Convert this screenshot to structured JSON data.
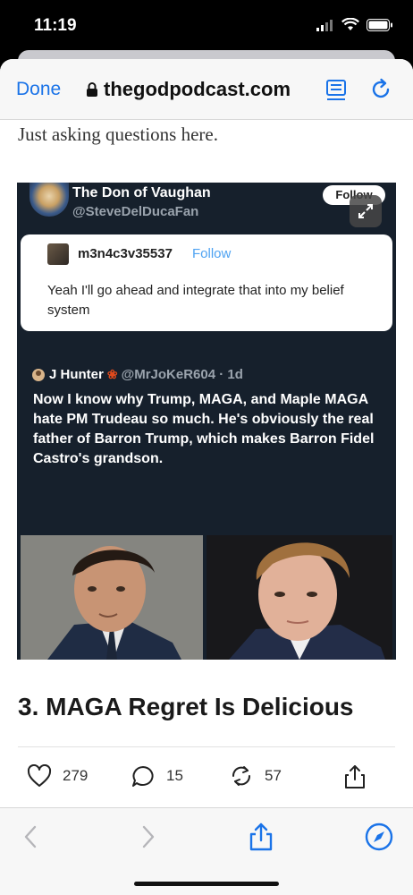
{
  "status_bar": {
    "time": "11:19"
  },
  "browser": {
    "done_label": "Done",
    "url": "thegodpodcast.com"
  },
  "article": {
    "partial_line": "Just asking questions here.",
    "heading": "3. MAGA Regret Is Delicious"
  },
  "embed": {
    "author_name": "The Don of Vaughan",
    "author_handle": "@SteveDelDucaFan",
    "follow_label": "Follow",
    "quote": {
      "username": "m3n4c3v35537",
      "follow_label": "Follow",
      "text": "Yeah I'll go ahead and integrate that into my belief system"
    },
    "reply": {
      "name": "J Hunter",
      "handle": "@MrJoKeR604 · 1d",
      "text": "Now I know why Trump, MAGA, and Maple MAGA hate PM Trudeau so much. He's obviously the real father of Barron Trump, which makes Barron Fidel Castro's grandson."
    }
  },
  "actions": {
    "likes": "279",
    "comments": "15",
    "reposts": "57"
  },
  "colors": {
    "accent": "#1a73e8",
    "embed_background": "#16202c",
    "quote_follow": "#4fa3f2"
  },
  "icons": [
    "lock-icon",
    "reader-icon",
    "reload-icon",
    "expand-icon",
    "heart-icon",
    "comment-icon",
    "repost-icon",
    "share-icon",
    "back-icon",
    "forward-icon",
    "compass-icon"
  ]
}
